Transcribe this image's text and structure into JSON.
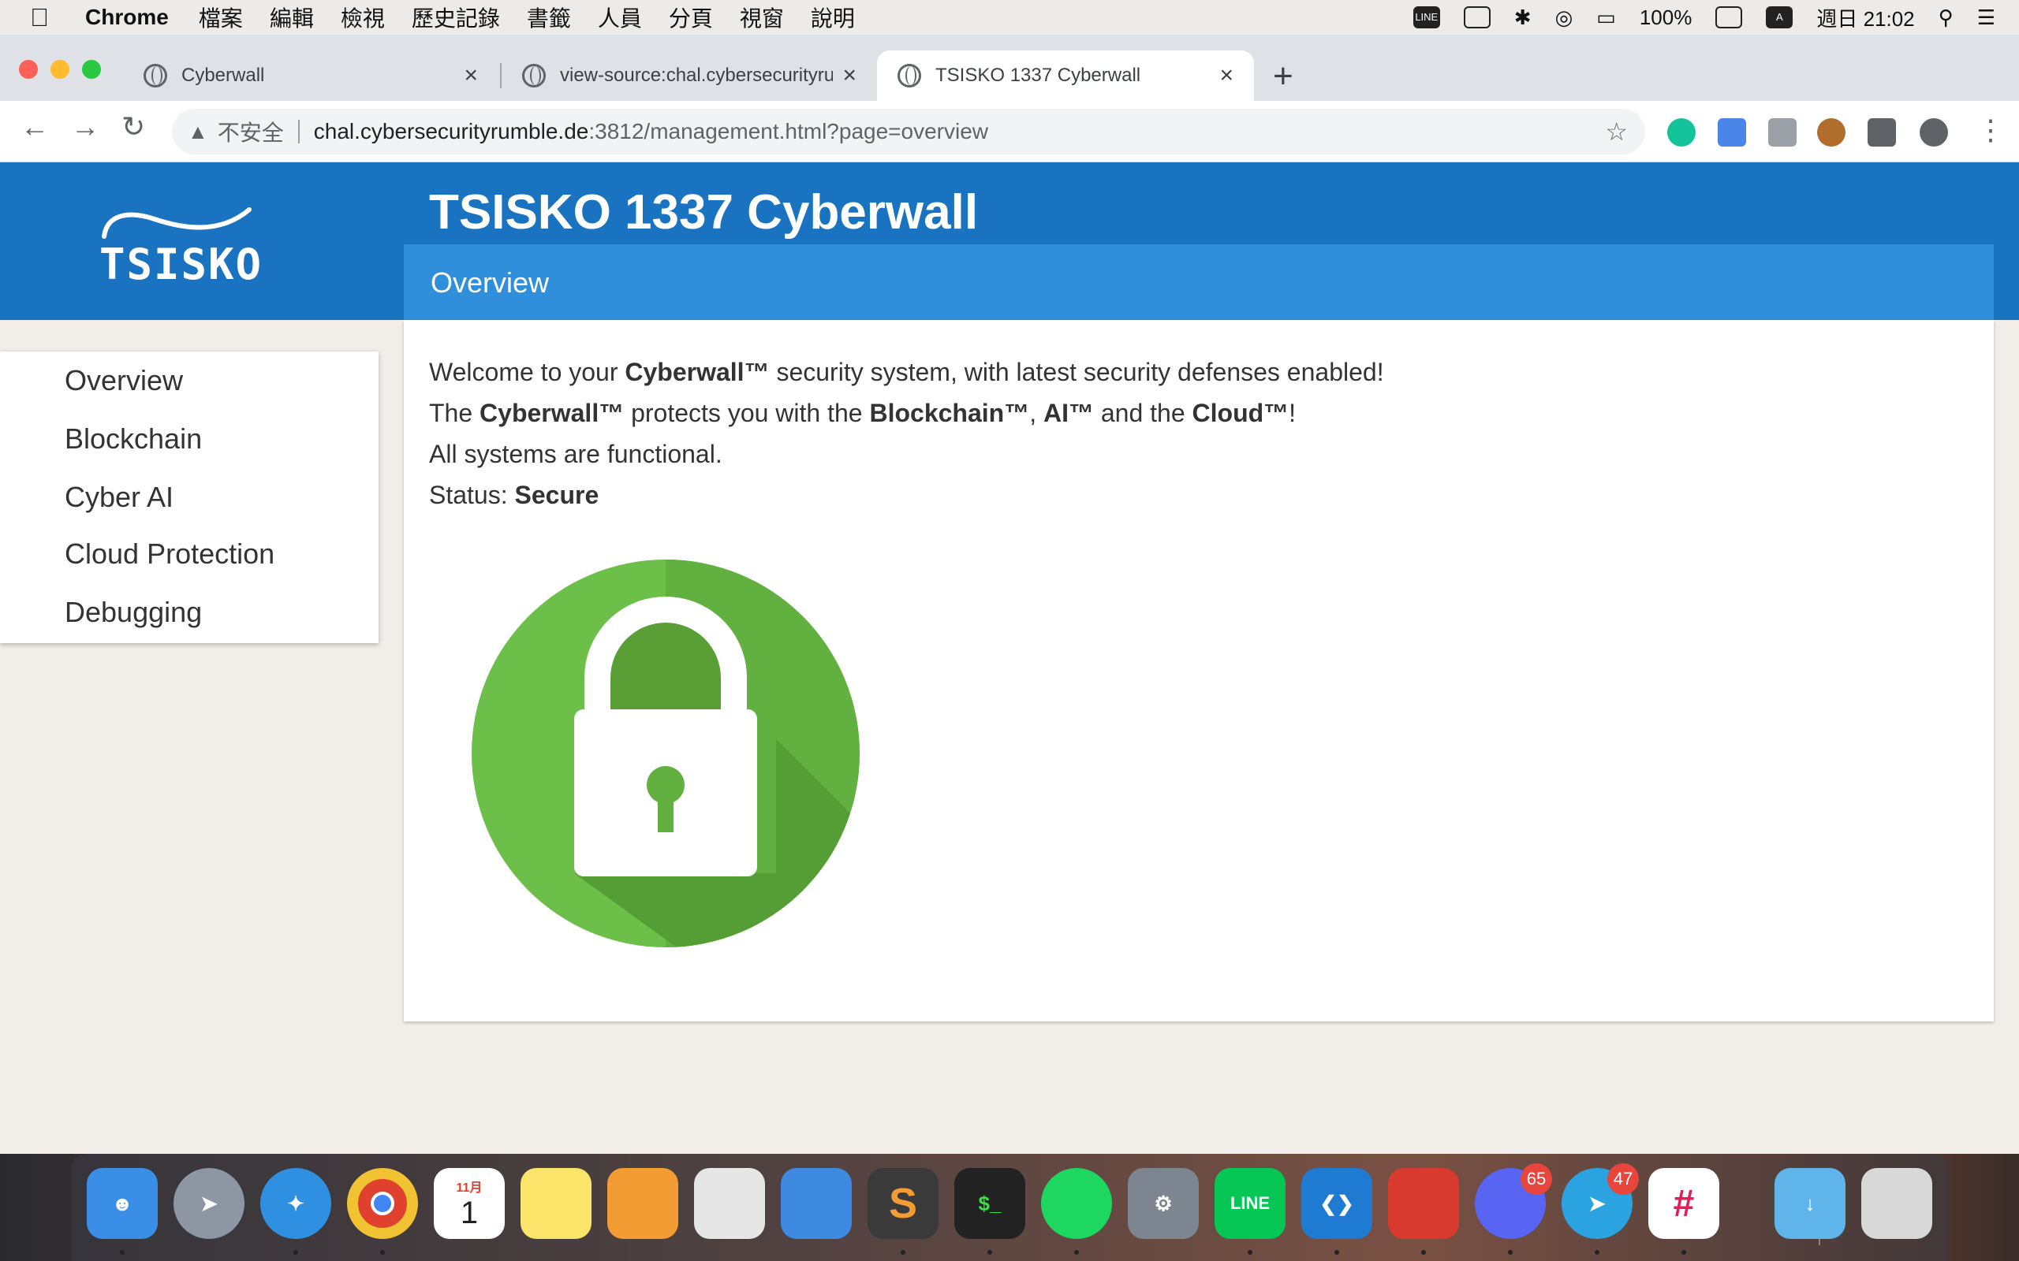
{
  "menubar": {
    "apple": "",
    "app_name": "Chrome",
    "items": [
      "檔案",
      "編輯",
      "檢視",
      "歷史記錄",
      "書籤",
      "人員",
      "分頁",
      "視窗",
      "說明"
    ],
    "battery": "100%",
    "input_method": "A",
    "clock": "週日 21:02"
  },
  "browser": {
    "tabs": [
      {
        "title": "Cyberwall"
      },
      {
        "title": "view-source:chal.cybersecurityrumble.de"
      },
      {
        "title": "TSISKO 1337 Cyberwall"
      }
    ],
    "new_tab": "+",
    "omnibox": {
      "security_label": "不安全",
      "host": "chal.cybersecurityrumble.de",
      "path": ":3812/management.html?page=overview"
    }
  },
  "site": {
    "logo_text": "TSISKO",
    "title": "TSISKO 1337 Cyberwall",
    "subheader": "Overview",
    "nav": [
      "Overview",
      "Blockchain",
      "Cyber AI",
      "Cloud Protection",
      "Debugging"
    ],
    "content": {
      "line1_a": "Welcome to your ",
      "line1_b": "Cyberwall™",
      "line1_c": " security system, with latest security defenses enabled!",
      "line2_a": "The ",
      "line2_b": "Cyberwall™",
      "line2_c": " protects you with the ",
      "line2_d": "Blockchain™",
      "line2_e": ", ",
      "line2_f": "AI™",
      "line2_g": " and the ",
      "line2_h": "Cloud™",
      "line2_i": "!",
      "line3": "All systems are functional.",
      "status_label": "Status: ",
      "status_value": "Secure"
    },
    "lock_icon": "padlock-icon",
    "colors": {
      "header": "#1a73c0",
      "subheader": "#2f8fdb",
      "lock_green": "#6cc04a"
    }
  },
  "dock": {
    "calendar_month": "11月",
    "calendar_day": "1",
    "discord_badge": "65",
    "telegram_badge": "47"
  }
}
